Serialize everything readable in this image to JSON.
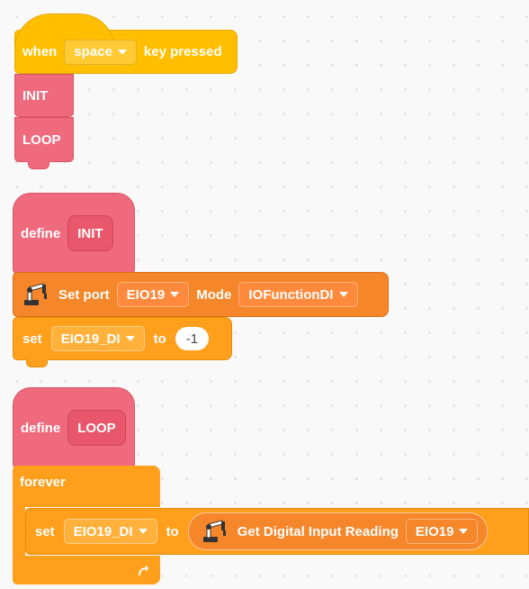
{
  "hat": {
    "when": "when",
    "key_value": "space",
    "key_pressed": "key pressed"
  },
  "script1": {
    "init_call": "INIT",
    "loop_call": "LOOP"
  },
  "define_init": {
    "define": "define",
    "name": "INIT"
  },
  "set_port": {
    "label": "Set port",
    "port_value": "EIO19",
    "mode_label": "Mode",
    "mode_value": "IOFunctionDI"
  },
  "set_var1": {
    "set": "set",
    "variable": "EIO19_DI",
    "to": "to",
    "value": "-1"
  },
  "define_loop": {
    "define": "define",
    "name": "LOOP"
  },
  "forever": {
    "label": "forever"
  },
  "set_var2": {
    "set": "set",
    "variable": "EIO19_DI",
    "to": "to"
  },
  "reporter": {
    "label": "Get Digital Input Reading",
    "port_value": "EIO19"
  },
  "colors": {
    "events": "#ffbf00",
    "my_blocks": "#f06a7e",
    "extension": "#f5862a",
    "variables": "#ff9f1c",
    "background": "#f9f9f9"
  }
}
